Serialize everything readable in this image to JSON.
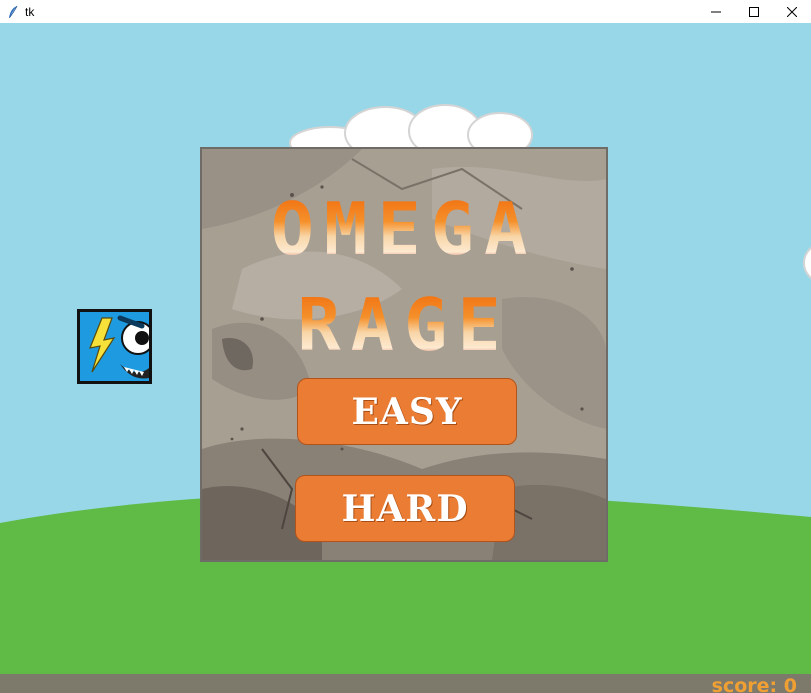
{
  "window": {
    "title": "tk",
    "controls": {
      "minimize_icon": "minimize-icon",
      "maximize_icon": "maximize-icon",
      "close_icon": "close-icon"
    }
  },
  "menu": {
    "title_line_1": "OMEGA",
    "title_line_2": "RAGE",
    "easy_label": "EASY",
    "hard_label": "HARD"
  },
  "hud": {
    "score_text": "score: 0"
  },
  "colors": {
    "sky": "#98d7e8",
    "grass": "#5fbb45",
    "ground_bar": "#7e7a6b",
    "button": "#ea7c33",
    "score": "#f0a033",
    "title_orange": "#f07a1c",
    "title_dark_red": "#9e1606",
    "player_blue": "#1e9be0"
  },
  "icons": {
    "app": "feather-icon",
    "player": "lightning-monster-icon"
  }
}
